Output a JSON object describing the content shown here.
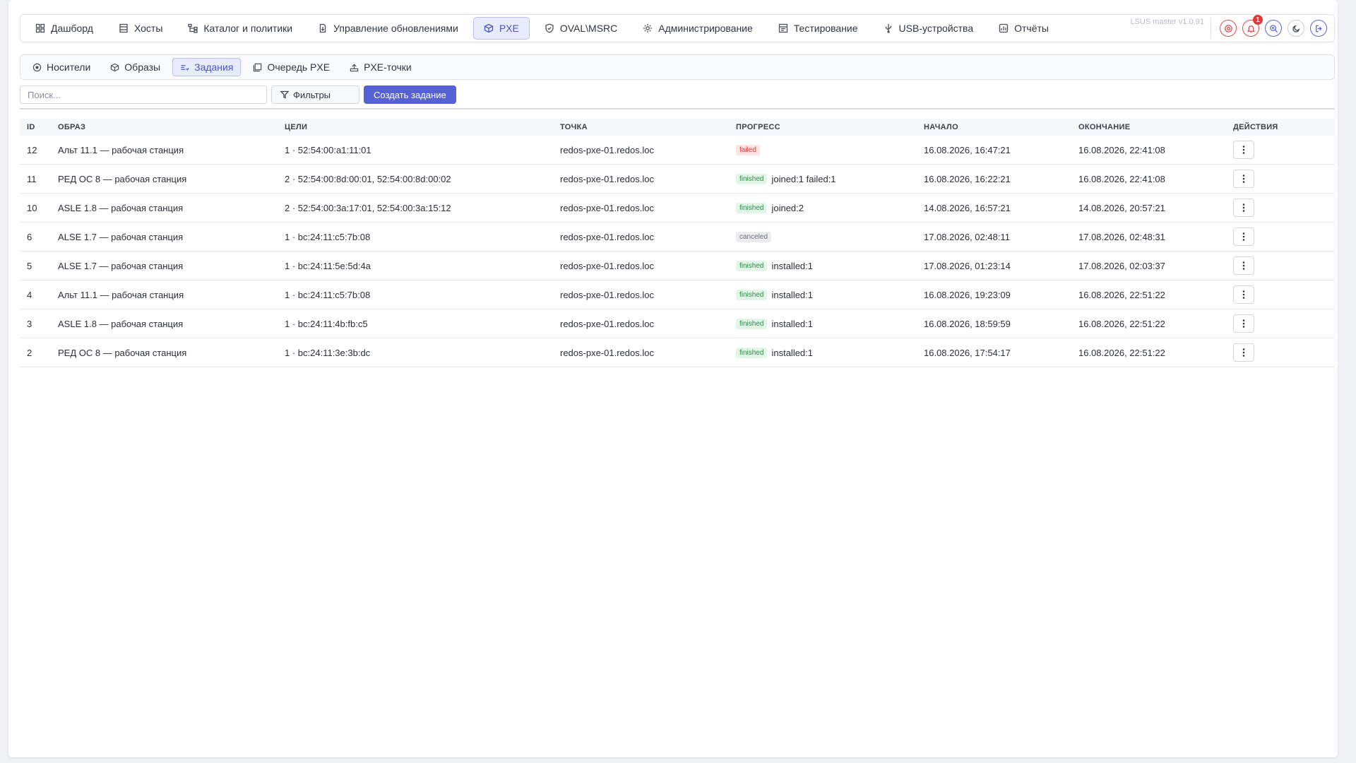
{
  "topnav": {
    "items": [
      {
        "label": "Дашборд",
        "icon": "dashboard-icon",
        "active": false
      },
      {
        "label": "Хосты",
        "icon": "server-icon",
        "active": false
      },
      {
        "label": "Каталог и политики",
        "icon": "tree-icon",
        "active": false
      },
      {
        "label": "Управление обновлениями",
        "icon": "update-icon",
        "active": false
      },
      {
        "label": "PXE",
        "icon": "cube-icon",
        "active": true
      },
      {
        "label": "OVAL\\MSRC",
        "icon": "shield-icon",
        "active": false
      },
      {
        "label": "Администрирование",
        "icon": "gear-icon",
        "active": false
      },
      {
        "label": "Тестирование",
        "icon": "checklist-icon",
        "active": false
      },
      {
        "label": "USB-устройства",
        "icon": "usb-icon",
        "active": false
      },
      {
        "label": "Отчёты",
        "icon": "report-icon",
        "active": false
      }
    ],
    "version": "LSUS master v1.0.91",
    "notifications_count": "1"
  },
  "subnav": {
    "items": [
      {
        "label": "Носители",
        "icon": "disc-icon",
        "active": false
      },
      {
        "label": "Образы",
        "icon": "cube-icon",
        "active": false
      },
      {
        "label": "Задания",
        "icon": "tasks-icon",
        "active": true
      },
      {
        "label": "Очередь PXE",
        "icon": "queue-icon",
        "active": false
      },
      {
        "label": "PXE-точки",
        "icon": "network-icon",
        "active": false
      }
    ]
  },
  "toolbar": {
    "search_placeholder": "Поиск...",
    "filters_label": "Фильтры",
    "create_label": "Создать задание"
  },
  "table": {
    "headers": {
      "id": "ID",
      "image": "ОБРАЗ",
      "targets": "ЦЕЛИ",
      "point": "ТОЧКА",
      "progress": "ПРОГРЕСС",
      "start": "НАЧАЛО",
      "end": "ОКОНЧАНИЕ",
      "actions": "ДЕЙСТВИЯ"
    },
    "rows": [
      {
        "id": "12",
        "image": "Альт 11.1 — рабочая станция",
        "targets": "1 · 52:54:00:a1:11:01",
        "point": "redos-pxe-01.redos.loc",
        "status": "failed",
        "progress": "",
        "start": "16.08.2026, 16:47:21",
        "end": "16.08.2026, 22:41:08"
      },
      {
        "id": "11",
        "image": "РЕД ОС 8 — рабочая станция",
        "targets": "2 · 52:54:00:8d:00:01, 52:54:00:8d:00:02",
        "point": "redos-pxe-01.redos.loc",
        "status": "finished",
        "progress": "joined:1 failed:1",
        "start": "16.08.2026, 16:22:21",
        "end": "16.08.2026, 22:41:08"
      },
      {
        "id": "10",
        "image": "ASLE 1.8 — рабочая станция",
        "targets": "2 · 52:54:00:3a:17:01, 52:54:00:3a:15:12",
        "point": "redos-pxe-01.redos.loc",
        "status": "finished",
        "progress": "joined:2",
        "start": "14.08.2026, 16:57:21",
        "end": "14.08.2026, 20:57:21"
      },
      {
        "id": "6",
        "image": "ALSE 1.7 — рабочая станция",
        "targets": "1 · bc:24:11:c5:7b:08",
        "point": "redos-pxe-01.redos.loc",
        "status": "canceled",
        "progress": "",
        "start": "17.08.2026, 02:48:11",
        "end": "17.08.2026, 02:48:31"
      },
      {
        "id": "5",
        "image": "ALSE 1.7 — рабочая станция",
        "targets": "1 · bc:24:11:5e:5d:4a",
        "point": "redos-pxe-01.redos.loc",
        "status": "finished",
        "progress": "installed:1",
        "start": "17.08.2026, 01:23:14",
        "end": "17.08.2026, 02:03:37"
      },
      {
        "id": "4",
        "image": "Альт 11.1 — рабочая станция",
        "targets": "1 · bc:24:11:c5:7b:08",
        "point": "redos-pxe-01.redos.loc",
        "status": "finished",
        "progress": "installed:1",
        "start": "16.08.2026, 19:23:09",
        "end": "16.08.2026, 22:51:22"
      },
      {
        "id": "3",
        "image": "ASLE 1.8 — рабочая станция",
        "targets": "1 · bc:24:11:4b:fb:c5",
        "point": "redos-pxe-01.redos.loc",
        "status": "finished",
        "progress": "installed:1",
        "start": "16.08.2026, 18:59:59",
        "end": "16.08.2026, 22:51:22"
      },
      {
        "id": "2",
        "image": "РЕД ОС 8 — рабочая станция",
        "targets": "1 · bc:24:11:3e:3b:dc",
        "point": "redos-pxe-01.redos.loc",
        "status": "finished",
        "progress": "installed:1",
        "start": "16.08.2026, 17:54:17",
        "end": "16.08.2026, 22:51:22"
      }
    ]
  },
  "colors": {
    "accent": "#5561d4",
    "finished": "#2f8a4b",
    "failed": "#d23b3b",
    "canceled": "#6b707a"
  }
}
